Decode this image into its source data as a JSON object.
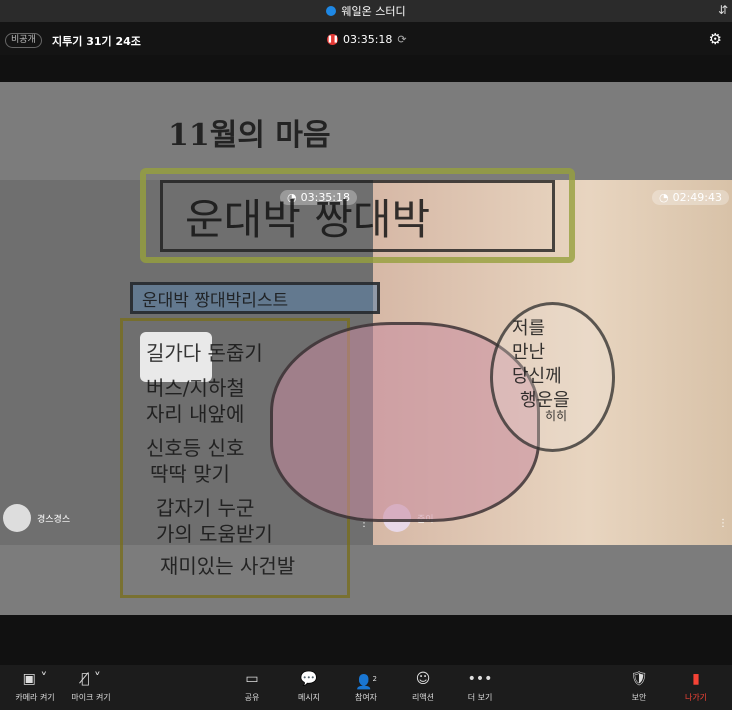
{
  "window": {
    "title": "웨일온 스터디"
  },
  "meeting": {
    "visibility": "비공개",
    "title": "지투기 31기 24조",
    "elapsed": "03:35:18"
  },
  "artwork": {
    "heading": "11월의 마음",
    "banner": "운대박 짱대박",
    "list_title": "운대박 짱대박리스트",
    "list": [
      "길가다 돈줍기",
      "버스/지하철",
      "자리 내앞에",
      "신호등 신호",
      "딱딱 맞기",
      "갑자기 누군",
      "가의 도움받기",
      "재미있는 사건발"
    ],
    "bubble": [
      "저를",
      "만난",
      "당신께",
      "행운을"
    ],
    "note": "히히"
  },
  "participants": [
    {
      "name": "경스경스",
      "timer": "03:35:18"
    },
    {
      "name": "준이",
      "timer": "02:49:43"
    }
  ],
  "toolbar": {
    "camera": "카메라 켜기",
    "mic": "마이크 켜기",
    "share": "공유",
    "message": "메시지",
    "participants": "참여자",
    "participants_count": "2",
    "reaction": "리액션",
    "more": "더 보기",
    "security": "보안",
    "leave": "나가기"
  },
  "colors": {
    "record": "#e53935",
    "leave": "#f44336",
    "accent": "#1e88e5"
  }
}
